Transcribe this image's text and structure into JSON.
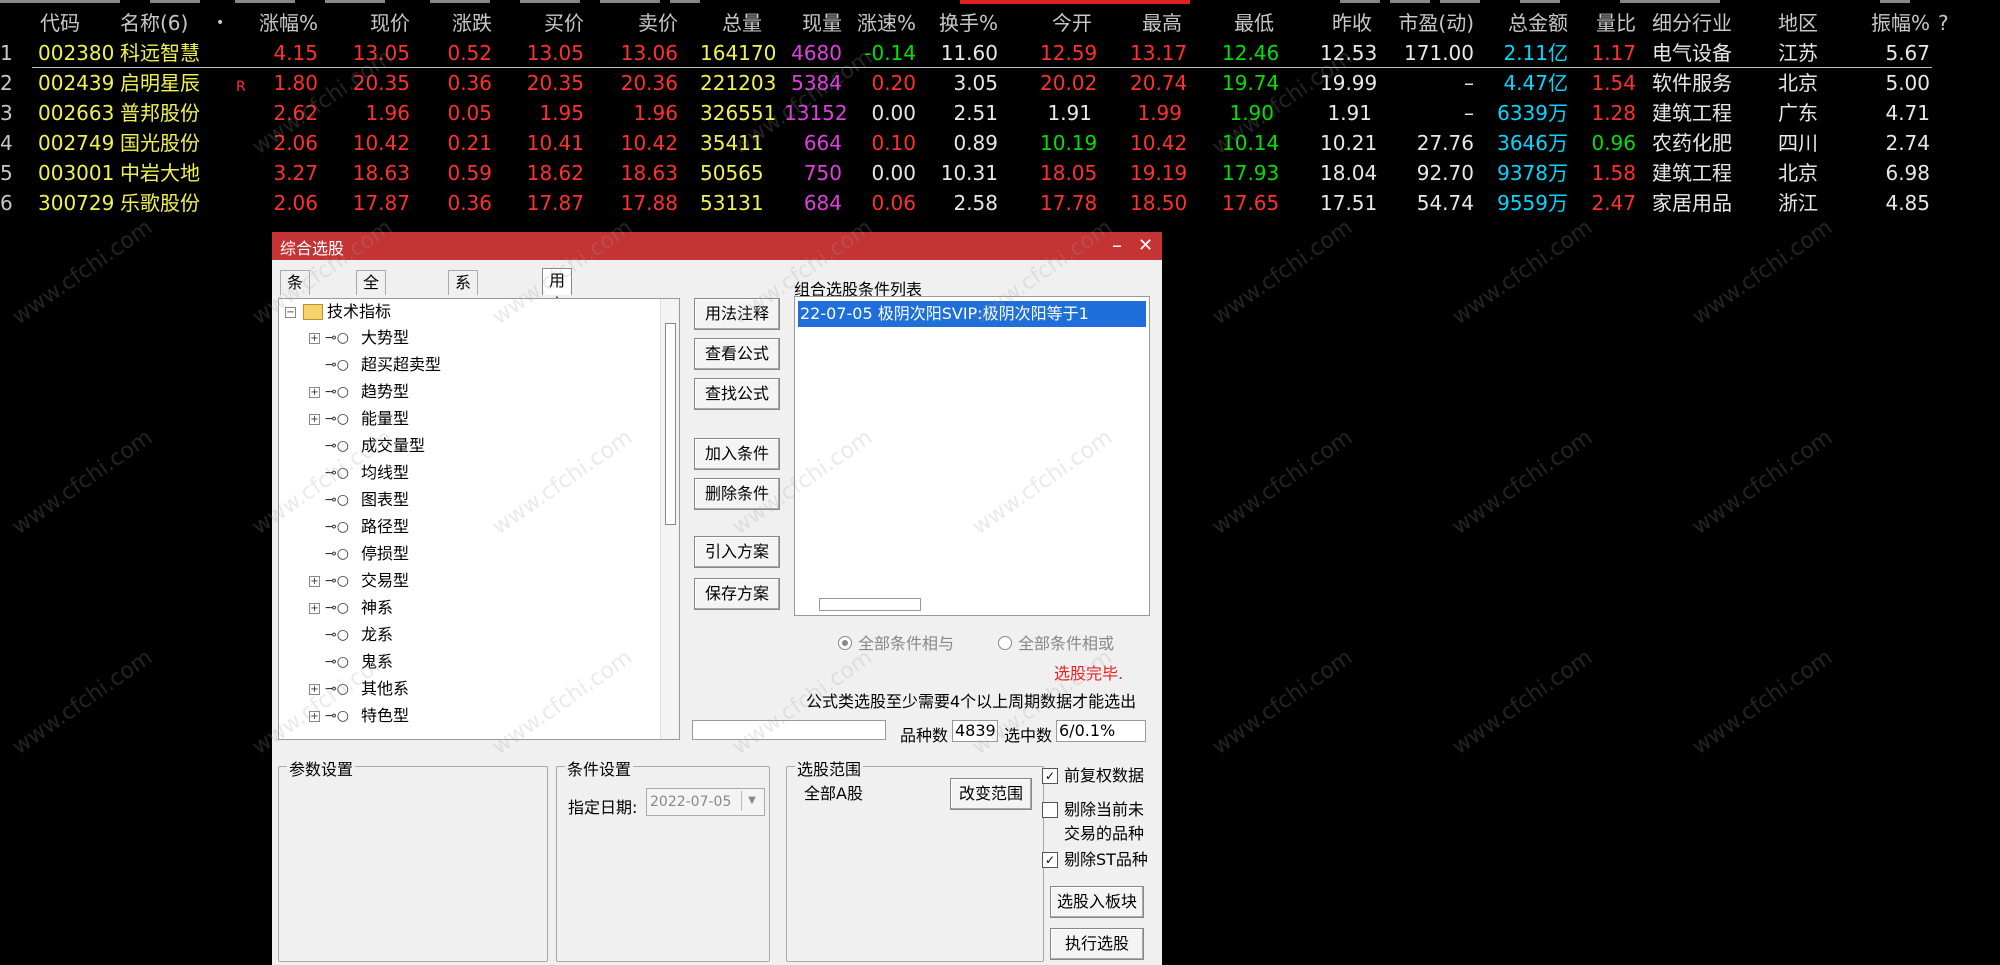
{
  "table": {
    "headers": [
      "代码",
      "名称(6)",
      "•",
      "涨幅%",
      "现价",
      "涨跌",
      "买价",
      "卖价",
      "总量",
      "现量",
      "涨速%",
      "换手%",
      "今开",
      "最高",
      "最低",
      "昨收",
      "市盈(动)",
      "总金额",
      "量比",
      "细分行业",
      "地区",
      "振幅%"
    ],
    "help_mark": "?",
    "rows": [
      {
        "idx": "1",
        "code": "002380",
        "name": "科远智慧",
        "flag": "",
        "pct": "4.15",
        "price": "13.05",
        "chg": "0.52",
        "bid": "13.05",
        "ask": "13.06",
        "vol": "164170",
        "cur": "4680",
        "speed": "-0.14",
        "turnover": "11.60",
        "open": "12.59",
        "high": "13.17",
        "low": "12.46",
        "prev": "12.53",
        "pe": "171.00",
        "amount": "2.11亿",
        "ratio": "1.17",
        "industry": "电气设备",
        "region": "江苏",
        "amp": "5.67"
      },
      {
        "idx": "2",
        "code": "002439",
        "name": "启明星辰",
        "flag": "R",
        "pct": "1.80",
        "price": "20.35",
        "chg": "0.36",
        "bid": "20.35",
        "ask": "20.36",
        "vol": "221203",
        "cur": "5384",
        "speed": "0.20",
        "turnover": "3.05",
        "open": "20.02",
        "high": "20.74",
        "low": "19.74",
        "prev": "19.99",
        "pe": "–",
        "amount": "4.47亿",
        "ratio": "1.54",
        "industry": "软件服务",
        "region": "北京",
        "amp": "5.00"
      },
      {
        "idx": "3",
        "code": "002663",
        "name": "普邦股份",
        "flag": "",
        "pct": "2.62",
        "price": "1.96",
        "chg": "0.05",
        "bid": "1.95",
        "ask": "1.96",
        "vol": "326551",
        "cur": "13152",
        "speed": "0.00",
        "turnover": "2.51",
        "open": "1.91",
        "high": "1.99",
        "low": "1.90",
        "prev": "1.91",
        "pe": "–",
        "amount": "6339万",
        "ratio": "1.28",
        "industry": "建筑工程",
        "region": "广东",
        "amp": "4.71"
      },
      {
        "idx": "4",
        "code": "002749",
        "name": "国光股份",
        "flag": "",
        "pct": "2.06",
        "price": "10.42",
        "chg": "0.21",
        "bid": "10.41",
        "ask": "10.42",
        "vol": "35411",
        "cur": "664",
        "speed": "0.10",
        "turnover": "0.89",
        "open": "10.19",
        "high": "10.42",
        "low": "10.14",
        "prev": "10.21",
        "pe": "27.76",
        "amount": "3646万",
        "ratio": "0.96",
        "industry": "农药化肥",
        "region": "四川",
        "amp": "2.74"
      },
      {
        "idx": "5",
        "code": "003001",
        "name": "中岩大地",
        "flag": "",
        "pct": "3.27",
        "price": "18.63",
        "chg": "0.59",
        "bid": "18.62",
        "ask": "18.63",
        "vol": "50565",
        "cur": "750",
        "speed": "0.00",
        "turnover": "10.31",
        "open": "18.05",
        "high": "19.19",
        "low": "17.93",
        "prev": "18.04",
        "pe": "92.70",
        "amount": "9378万",
        "ratio": "1.58",
        "industry": "建筑工程",
        "region": "北京",
        "amp": "6.98"
      },
      {
        "idx": "6",
        "code": "300729",
        "name": "乐歌股份",
        "flag": "",
        "pct": "2.06",
        "price": "17.87",
        "chg": "0.36",
        "bid": "17.87",
        "ask": "17.88",
        "vol": "53131",
        "cur": "684",
        "speed": "0.06",
        "turnover": "2.58",
        "open": "17.78",
        "high": "18.50",
        "low": "17.65",
        "prev": "17.51",
        "pe": "54.74",
        "amount": "9559万",
        "ratio": "2.47",
        "industry": "家居用品",
        "region": "浙江",
        "amp": "4.85"
      }
    ]
  },
  "dialog": {
    "title": "综合选股",
    "minimize_glyph": "–",
    "close_glyph": "✕",
    "tabs": [
      "条件组",
      "全部条件",
      "系统条件",
      "用户条件"
    ],
    "tree": {
      "root": "技术指标",
      "items": [
        {
          "label": "大势型",
          "expandable": true
        },
        {
          "label": "超买超卖型",
          "expandable": false
        },
        {
          "label": "趋势型",
          "expandable": true
        },
        {
          "label": "能量型",
          "expandable": true
        },
        {
          "label": "成交量型",
          "expandable": false
        },
        {
          "label": "均线型",
          "expandable": false
        },
        {
          "label": "图表型",
          "expandable": false
        },
        {
          "label": "路径型",
          "expandable": false
        },
        {
          "label": "停损型",
          "expandable": false
        },
        {
          "label": "交易型",
          "expandable": true
        },
        {
          "label": "神系",
          "expandable": true
        },
        {
          "label": "龙系",
          "expandable": false
        },
        {
          "label": "鬼系",
          "expandable": false
        },
        {
          "label": "其他系",
          "expandable": true
        },
        {
          "label": "特色型",
          "expandable": true
        }
      ]
    },
    "buttons": {
      "usage_note": "用法注释",
      "view_formula": "查看公式",
      "find_formula": "查找公式",
      "add_condition": "加入条件",
      "delete_condition": "删除条件",
      "import_plan": "引入方案",
      "save_plan": "保存方案",
      "change_range": "改变范围",
      "select_to_block": "选股入板块",
      "execute": "执行选股"
    },
    "condition_list_label": "组合选股条件列表",
    "condition_list": [
      "22-07-05 极阴次阳SVIP:极阴次阳等于1"
    ],
    "radio_and": "全部条件相与",
    "radio_or": "全部条件相或",
    "status_done": "选股完毕.",
    "note": "公式类选股至少需要4个以上周期数据才能选出",
    "count_label": "品种数",
    "count_value": "4839",
    "selected_label": "选中数",
    "selected_value": "6/0.1%",
    "param_group": "参数设置",
    "cond_group": "条件设置",
    "date_label": "指定日期:",
    "date_value": "2022-07-05",
    "range_group": "选股范围",
    "range_value": "全部A股",
    "chk_adjust": "前复权数据",
    "chk_exclude_untraded_1": "剔除当前未",
    "chk_exclude_untraded_2": "交易的品种",
    "chk_exclude_st": "剔除ST品种"
  },
  "watermark": "www.cfchi.com"
}
